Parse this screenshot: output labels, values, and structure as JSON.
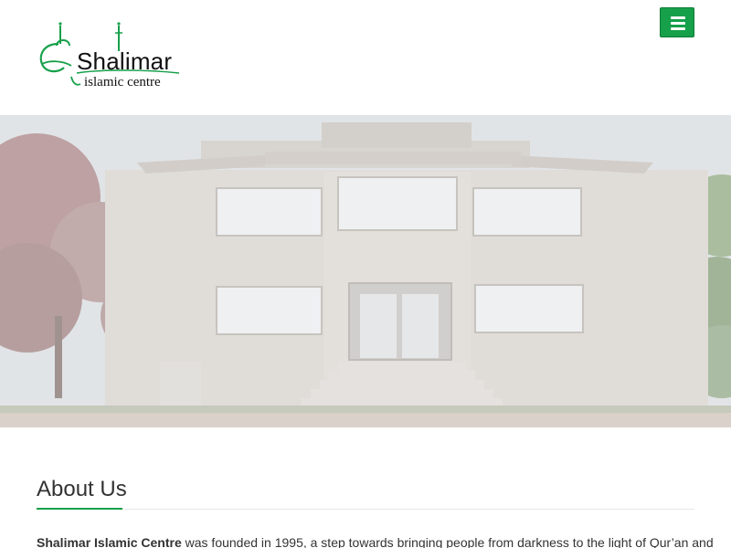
{
  "header": {
    "logo": {
      "wordmark": "Shalimar",
      "subtitle": "islamic centre",
      "brand_color": "#16a04a"
    },
    "menu_icon": "hamburger-icon",
    "menu_button_color": "#16a04a"
  },
  "hero": {
    "image_subject": "Shalimar Islamic Centre building facade"
  },
  "about": {
    "heading": "About Us",
    "intro_bold": "Shalimar Islamic Centre",
    "intro_text": " was founded in 1995, a step towards bringing people from darkness to the light of Qur’an and"
  }
}
